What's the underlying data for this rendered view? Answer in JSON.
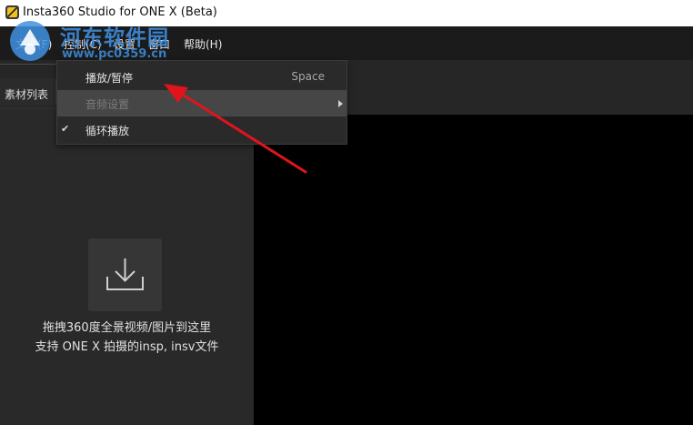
{
  "window": {
    "title": "Insta360 Studio for ONE X (Beta)"
  },
  "menubar": {
    "items": [
      {
        "label": "文件(F)"
      },
      {
        "label": "控制(C)"
      },
      {
        "label": "设置"
      },
      {
        "label": "窗口"
      },
      {
        "label": "帮助(H)"
      }
    ]
  },
  "watermark": {
    "title": "河东软件园",
    "url": "www.pc0359.cn"
  },
  "sidebar": {
    "tab_label": "素材列表",
    "drop_line1": "拖拽360度全景视频/图片到这里",
    "drop_line2": "支持 ONE X 拍摄的insp, insv文件"
  },
  "control_menu": {
    "items": [
      {
        "label": "播放/暂停",
        "shortcut": "Space",
        "checked": false,
        "submenu": false,
        "highlighted": false
      },
      {
        "label": "音频设置",
        "shortcut": "",
        "checked": false,
        "submenu": true,
        "highlighted": true
      },
      {
        "label": "循环播放",
        "shortcut": "",
        "checked": true,
        "submenu": false,
        "highlighted": false
      }
    ],
    "check_glyph": "✔"
  },
  "colors": {
    "menubar_bg": "#1b1b1b",
    "panel_bg": "#292929",
    "highlight_bg": "#464646",
    "annotation_arrow": "#e0141c",
    "watermark": "#3f8fe0"
  },
  "icons": {
    "app": "insta360-logo-icon",
    "drop": "download-tray-icon",
    "submenu": "chevron-right-icon",
    "check": "checkmark-icon"
  }
}
